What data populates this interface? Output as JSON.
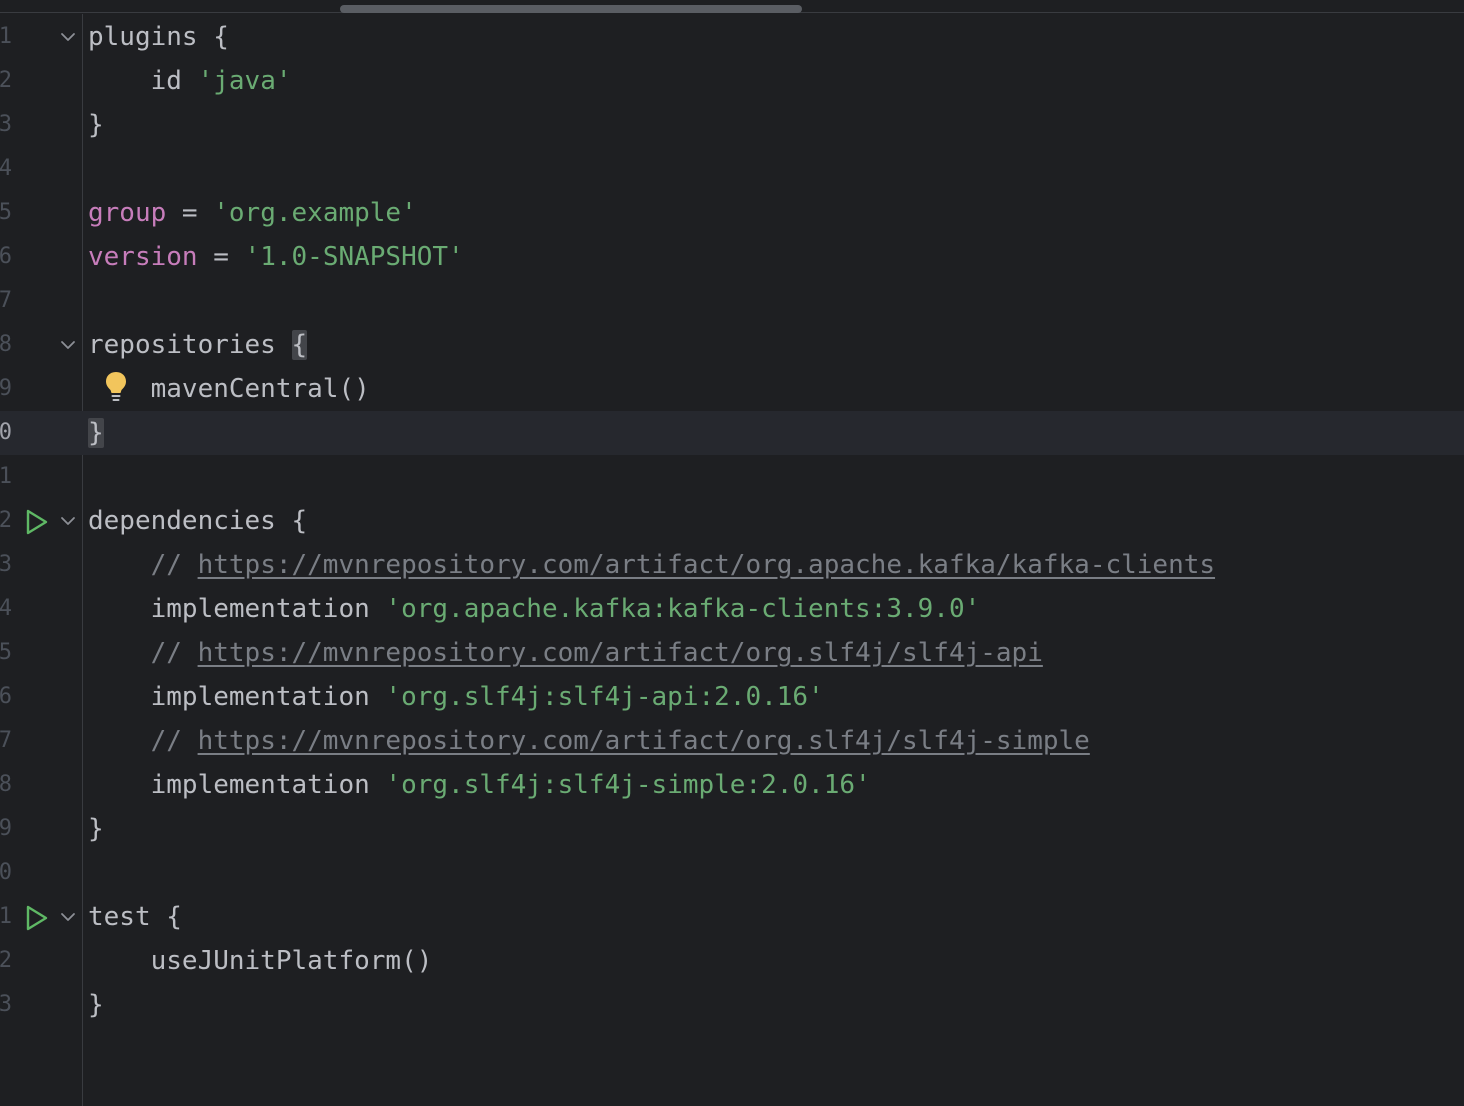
{
  "editor": {
    "lines": [
      {
        "num": "1",
        "parts": [
          {
            "t": "plugins {",
            "c": "kw"
          }
        ]
      },
      {
        "num": "2",
        "parts": [
          {
            "t": "    id ",
            "c": "kw"
          },
          {
            "t": "'java'",
            "c": "str"
          }
        ]
      },
      {
        "num": "3",
        "parts": [
          {
            "t": "}",
            "c": "kw"
          }
        ]
      },
      {
        "num": "4",
        "parts": []
      },
      {
        "num": "5",
        "parts": [
          {
            "t": "group",
            "c": "prop"
          },
          {
            "t": " = ",
            "c": "kw"
          },
          {
            "t": "'org.example'",
            "c": "str"
          }
        ]
      },
      {
        "num": "6",
        "parts": [
          {
            "t": "version",
            "c": "prop"
          },
          {
            "t": " = ",
            "c": "kw"
          },
          {
            "t": "'1.0-SNAPSHOT'",
            "c": "str"
          }
        ]
      },
      {
        "num": "7",
        "parts": []
      },
      {
        "num": "8",
        "parts": [
          {
            "t": "repositories ",
            "c": "kw"
          },
          {
            "t": "{",
            "c": "kw brace-hl"
          }
        ]
      },
      {
        "num": "9",
        "parts": [
          {
            "t": "    mavenCentral()",
            "c": "kw"
          }
        ]
      },
      {
        "num": "0",
        "parts": [
          {
            "t": "}",
            "c": "kw brace-hl"
          }
        ]
      },
      {
        "num": "1",
        "parts": []
      },
      {
        "num": "2",
        "parts": [
          {
            "t": "dependencies {",
            "c": "kw"
          }
        ]
      },
      {
        "num": "3",
        "parts": [
          {
            "t": "    // ",
            "c": "cmt"
          },
          {
            "t": "https://mvnrepository.com/artifact/org.apache.kafka/kafka-clients",
            "c": "link"
          }
        ]
      },
      {
        "num": "4",
        "parts": [
          {
            "t": "    implementation ",
            "c": "kw"
          },
          {
            "t": "'org.apache.kafka:kafka-clients:3.9.0'",
            "c": "str"
          }
        ]
      },
      {
        "num": "5",
        "parts": [
          {
            "t": "    // ",
            "c": "cmt"
          },
          {
            "t": "https://mvnrepository.com/artifact/org.slf4j/slf4j-api",
            "c": "link"
          }
        ]
      },
      {
        "num": "6",
        "parts": [
          {
            "t": "    implementation ",
            "c": "kw"
          },
          {
            "t": "'org.slf4j:slf4j-api:2.0.16'",
            "c": "str"
          }
        ]
      },
      {
        "num": "7",
        "parts": [
          {
            "t": "    // ",
            "c": "cmt"
          },
          {
            "t": "https://mvnrepository.com/artifact/org.slf4j/slf4j-simple",
            "c": "link"
          }
        ]
      },
      {
        "num": "8",
        "parts": [
          {
            "t": "    implementation ",
            "c": "kw"
          },
          {
            "t": "'org.slf4j:slf4j-simple:2.0.16'",
            "c": "str"
          }
        ]
      },
      {
        "num": "9",
        "parts": [
          {
            "t": "}",
            "c": "kw"
          }
        ]
      },
      {
        "num": "0",
        "parts": []
      },
      {
        "num": "1",
        "parts": [
          {
            "t": "test {",
            "c": "kw"
          }
        ]
      },
      {
        "num": "2",
        "parts": [
          {
            "t": "    useJUnitPlatform()",
            "c": "kw"
          }
        ]
      },
      {
        "num": "3",
        "parts": [
          {
            "t": "}",
            "c": "kw"
          }
        ]
      }
    ],
    "current_line_index": 9,
    "fold_markers": [
      0,
      7,
      11,
      20
    ],
    "run_markers": [
      11,
      20
    ],
    "bulb_marker": 8,
    "icons": {
      "run": "run-gutter-icon",
      "fold": "chevron-down-icon",
      "bulb": "lightbulb-icon"
    },
    "colors": {
      "background": "#1e1f22",
      "current_line": "#26282e",
      "text": "#bcbec4",
      "string": "#6aab73",
      "property": "#c77dbb",
      "comment": "#7a7e85",
      "run": "#5fb865",
      "bulb": "#f2c55c"
    }
  }
}
